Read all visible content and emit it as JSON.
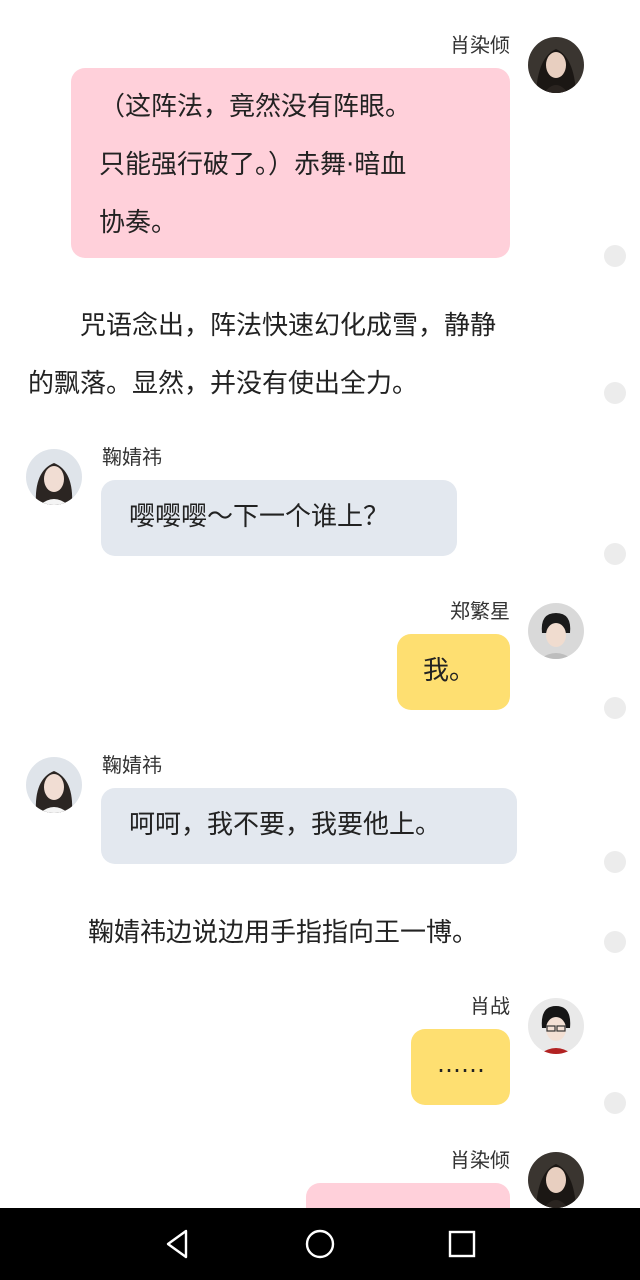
{
  "chat": {
    "msg1": {
      "speaker": "肖染倾",
      "lines": [
        "（这阵法，竟然没有阵眼。",
        "只能强行破了。）赤舞·暗血",
        "协奏。"
      ],
      "bubble_color": "#ffd0da"
    },
    "narration1": {
      "lines": [
        "　　咒语念出，阵法快速幻化成雪，静静",
        "的飘落。显然，并没有使出全力。"
      ]
    },
    "msg2": {
      "speaker": "鞠婧祎",
      "text": "嘤嘤嘤～下一个谁上？",
      "bubble_color": "#e3e8ef"
    },
    "msg3": {
      "speaker": "郑繁星",
      "text": "我。",
      "bubble_color": "#fedf71"
    },
    "msg4": {
      "speaker": "鞠婧祎",
      "text": "呵呵，我不要，我要他上。",
      "bubble_color": "#e3e8ef"
    },
    "narration2": {
      "text": "鞠婧祎边说边用手指指向王一博。"
    },
    "msg5": {
      "speaker": "肖战",
      "text": "……",
      "bubble_color": "#fedf71"
    },
    "msg6": {
      "speaker": "肖染倾",
      "bubble_color": "#ffd0da"
    }
  },
  "navbar": {
    "icons": [
      "back-triangle-icon",
      "home-circle-icon",
      "recents-square-icon"
    ]
  }
}
